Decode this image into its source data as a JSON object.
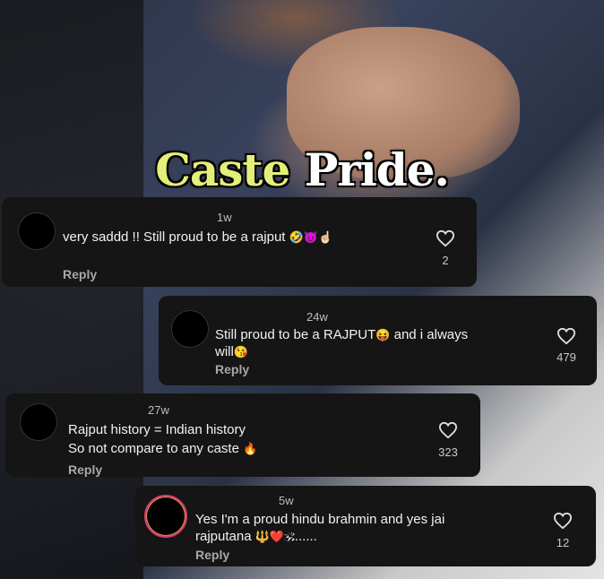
{
  "video": {
    "overlay_title_part1": "Caste",
    "overlay_title_part2": "Pride."
  },
  "comments": [
    {
      "time": "1w",
      "line1": "very saddd !! Still proud to be a rajput",
      "emoji": "🤣😈☝🏻",
      "likes": "2",
      "reply_label": "Reply"
    },
    {
      "time": "24w",
      "line1": "Still proud to be a RAJPUT",
      "emoji1": "😝",
      "line1b": " and i always",
      "line2": "will",
      "emoji2": "😘",
      "likes": "479",
      "reply_label": "Reply"
    },
    {
      "time": "27w",
      "line1": "Rajput history = Indian history",
      "line2": "So not compare to any caste",
      "emoji": "🔥",
      "likes": "323",
      "reply_label": "Reply"
    },
    {
      "time": "5w",
      "line1": "Yes I'm a proud hindu brahmin and yes jai",
      "line2a": "rajputana",
      "emoji": "🔱❤️🕉",
      "line2b": "......",
      "likes": "12",
      "reply_label": "Reply"
    }
  ]
}
